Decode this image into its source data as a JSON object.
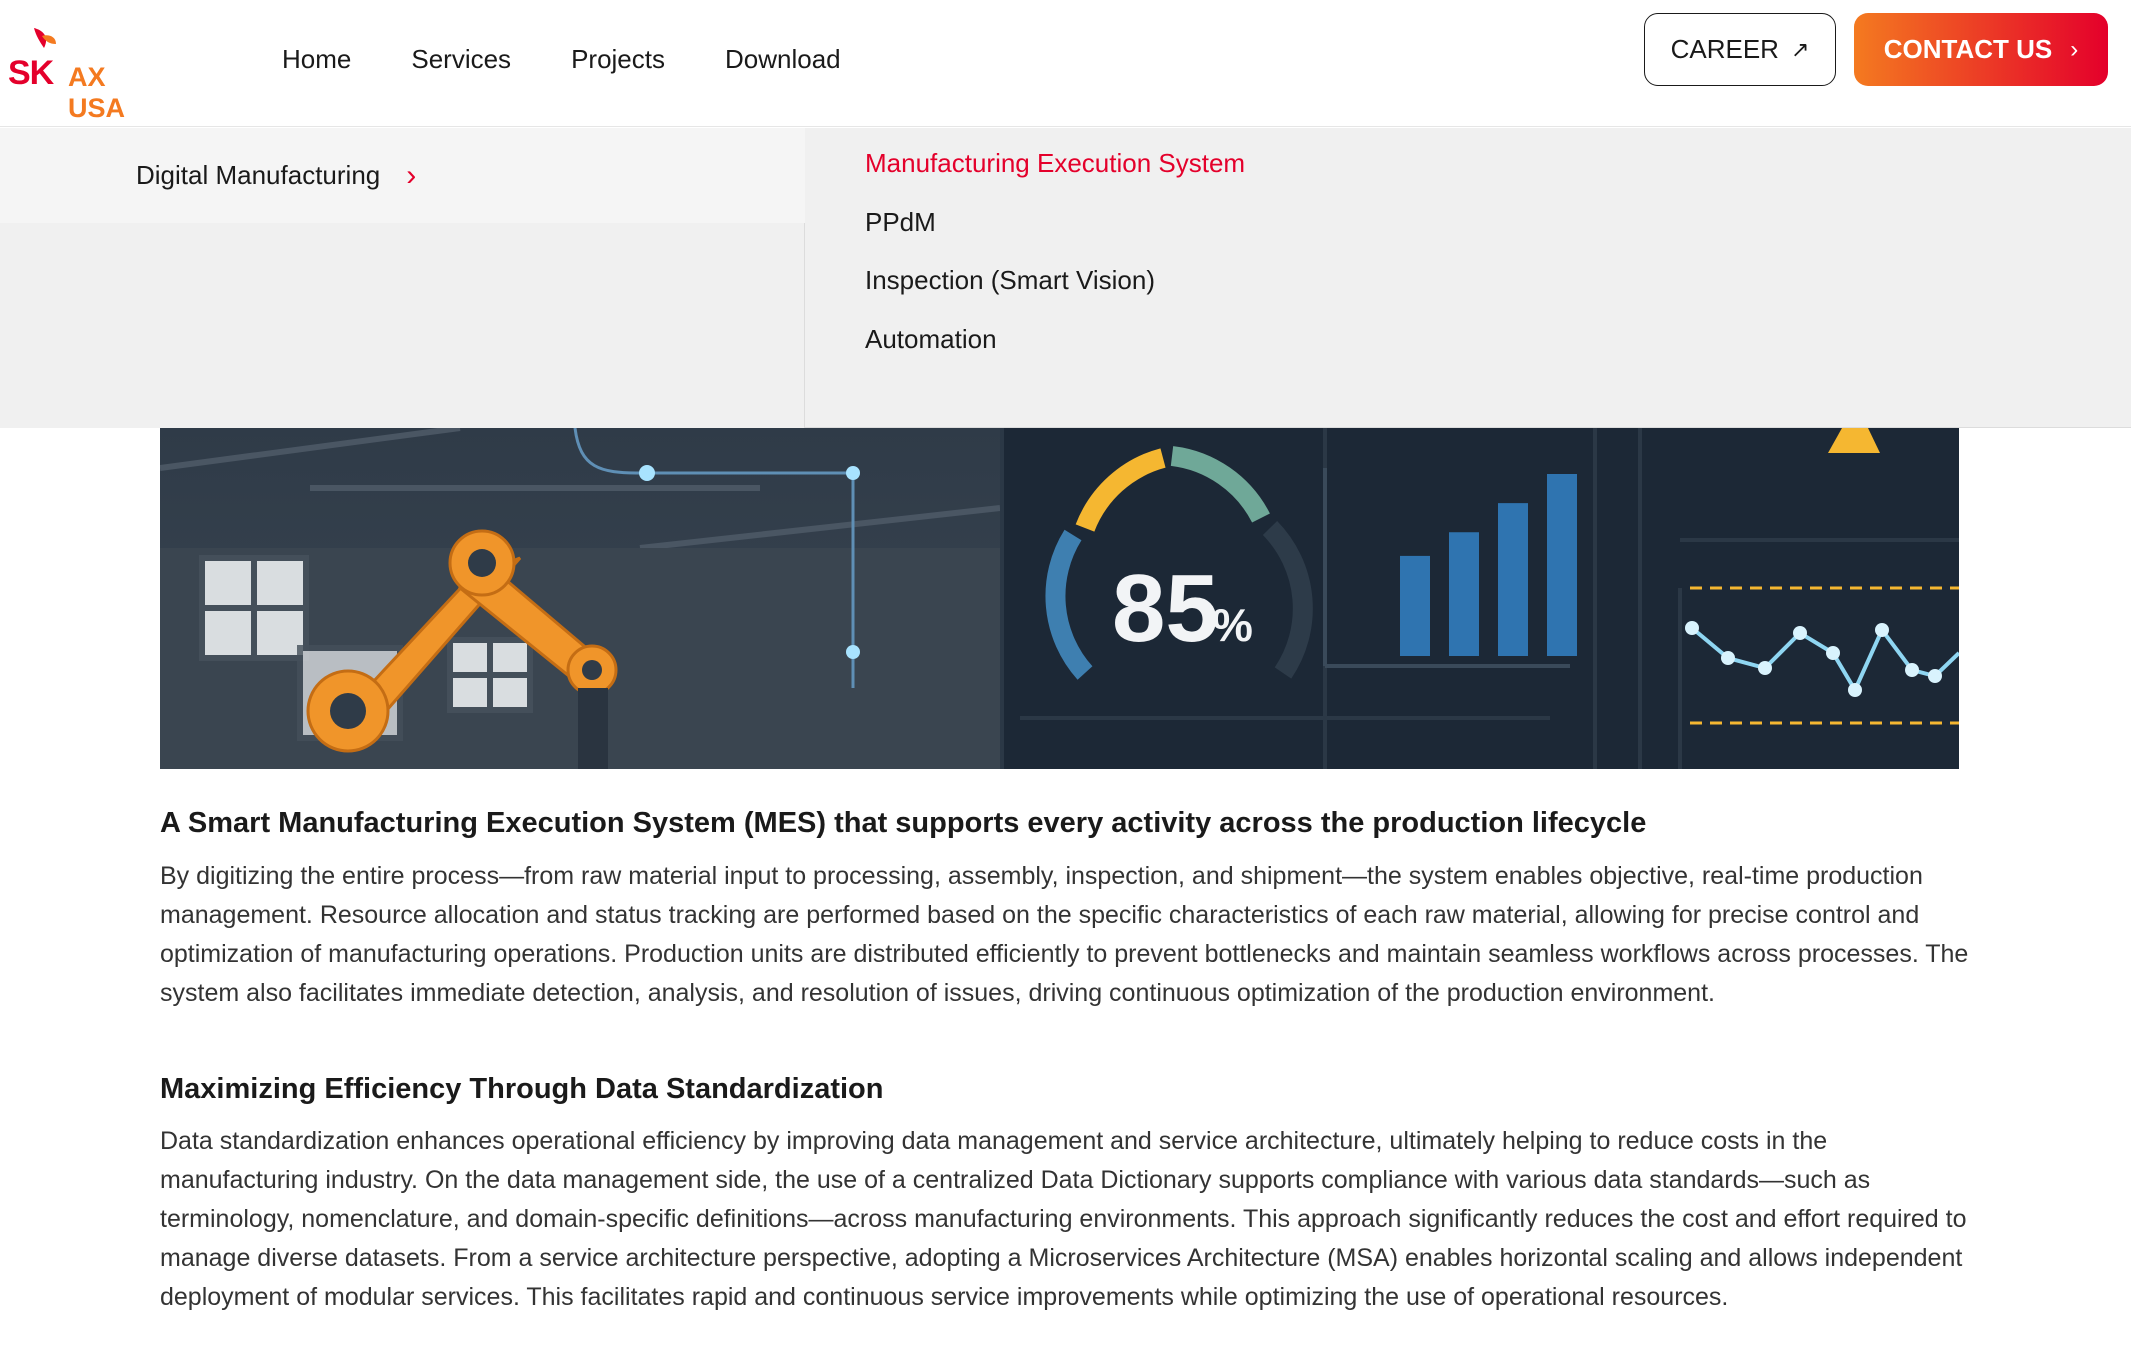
{
  "header": {
    "logo": {
      "sk": "SK",
      "suffix": "AX USA"
    },
    "nav": [
      {
        "label": "Home"
      },
      {
        "label": "Services"
      },
      {
        "label": "Projects"
      },
      {
        "label": "Download"
      }
    ],
    "career_label": "CAREER",
    "contact_label": "CONTACT US"
  },
  "mega_menu": {
    "category": "Digital Manufacturing",
    "items": [
      {
        "label": "Manufacturing Execution System",
        "active": true
      },
      {
        "label": "PPdM",
        "active": false
      },
      {
        "label": "Inspection (Smart Vision)",
        "active": false
      },
      {
        "label": "Automation",
        "active": false
      }
    ]
  },
  "hero": {
    "gauge_value": "85",
    "gauge_unit": "%",
    "bars": [
      0.55,
      0.68,
      0.84,
      1.0
    ],
    "colors": {
      "bg": "#1c2836",
      "robot": "#f0952a",
      "gauge_yellow": "#f5b731",
      "gauge_teal": "#6fa898",
      "gauge_blue": "#3e7fb0",
      "bar": "#2f74b0",
      "alert": "#f5b731"
    }
  },
  "sections": [
    {
      "title": "A Smart Manufacturing Execution System (MES) that supports every activity across the production lifecycle",
      "body": "By digitizing the entire process—from raw material input to processing, assembly, inspection, and shipment—the system enables objective, real-time production management. Resource allocation and status tracking are performed based on the specific characteristics of each raw material, allowing for precise control and optimization of manufacturing operations. Production units are distributed efficiently to prevent bottlenecks and maintain seamless workflows across processes. The system also facilitates immediate detection, analysis, and resolution of issues, driving continuous optimization of the production environment."
    },
    {
      "title": "Maximizing Efficiency Through Data Standardization",
      "body": "Data standardization enhances operational efficiency by improving data management and service architecture, ultimately helping to reduce costs in the manufacturing industry. On the data management side, the use of a centralized Data Dictionary supports compliance with various data standards—such as terminology, nomenclature, and domain-specific definitions—across manufacturing environments. This approach significantly reduces the cost and effort required to manage diverse datasets. From a service architecture perspective, adopting a Microservices Architecture (MSA) enables horizontal scaling and allows independent deployment of modular services. This facilitates rapid and continuous service improvements while optimizing the use of operational resources."
    }
  ]
}
